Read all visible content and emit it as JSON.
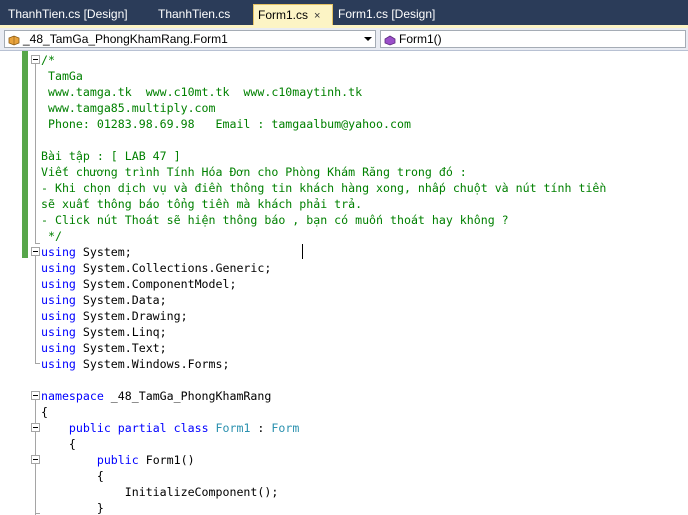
{
  "tabs": [
    {
      "label": "ThanhTien.cs [Design]",
      "active": false
    },
    {
      "label": "ThanhTien.cs",
      "active": false
    },
    {
      "label": "Form1.cs",
      "active": true,
      "close": "×"
    },
    {
      "label": "Form1.cs [Design]",
      "active": false
    }
  ],
  "nav": {
    "type_dropdown": "_48_TamGa_PhongKhamRang.Form1",
    "member_dropdown": "Form1()"
  },
  "code_lines": [
    [
      {
        "t": "/*",
        "c": "cm"
      }
    ],
    [
      {
        "t": " TamGa",
        "c": "cm"
      }
    ],
    [
      {
        "t": " www.tamga.tk  www.c10mt.tk  www.c10maytinh.tk",
        "c": "cm"
      }
    ],
    [
      {
        "t": " www.tamga85.multiply.com",
        "c": "cm"
      }
    ],
    [
      {
        "t": " Phone: 01283.98.69.98   Email : tamgaalbum@yahoo.com",
        "c": "cm"
      }
    ],
    [],
    [
      {
        "t": "Bài tập : [ LAB 47 ]",
        "c": "cm"
      }
    ],
    [
      {
        "t": "Viết chương trình Tính Hóa Đơn cho Phòng Khám Răng trong đó :",
        "c": "cm"
      }
    ],
    [
      {
        "t": "- Khi chọn dịch vụ và điền thông tin khách hàng xong, nhấp chuột và nút tính tiền",
        "c": "cm"
      }
    ],
    [
      {
        "t": "sẽ xuất thông báo tổng tiền mà khách phải trả.",
        "c": "cm"
      }
    ],
    [
      {
        "t": "- Click nút Thoát sẽ hiện thông báo , bạn có muốn thoát hay không ?",
        "c": "cm"
      }
    ],
    [
      {
        "t": " */",
        "c": "cm"
      }
    ],
    [
      {
        "t": "using",
        "c": "kw"
      },
      {
        "t": " System;",
        "c": ""
      }
    ],
    [
      {
        "t": "using",
        "c": "kw"
      },
      {
        "t": " System.Collections.Generic;",
        "c": ""
      }
    ],
    [
      {
        "t": "using",
        "c": "kw"
      },
      {
        "t": " System.ComponentModel;",
        "c": ""
      }
    ],
    [
      {
        "t": "using",
        "c": "kw"
      },
      {
        "t": " System.Data;",
        "c": ""
      }
    ],
    [
      {
        "t": "using",
        "c": "kw"
      },
      {
        "t": " System.Drawing;",
        "c": ""
      }
    ],
    [
      {
        "t": "using",
        "c": "kw"
      },
      {
        "t": " System.Linq;",
        "c": ""
      }
    ],
    [
      {
        "t": "using",
        "c": "kw"
      },
      {
        "t": " System.Text;",
        "c": ""
      }
    ],
    [
      {
        "t": "using",
        "c": "kw"
      },
      {
        "t": " System.Windows.Forms;",
        "c": ""
      }
    ],
    [],
    [
      {
        "t": "namespace",
        "c": "kw"
      },
      {
        "t": " _48_TamGa_PhongKhamRang",
        "c": ""
      }
    ],
    [
      {
        "t": "{",
        "c": ""
      }
    ],
    [
      {
        "t": "    ",
        "c": ""
      },
      {
        "t": "public",
        "c": "kw"
      },
      {
        "t": " ",
        "c": ""
      },
      {
        "t": "partial",
        "c": "kw"
      },
      {
        "t": " ",
        "c": ""
      },
      {
        "t": "class",
        "c": "kw"
      },
      {
        "t": " ",
        "c": ""
      },
      {
        "t": "Form1",
        "c": "ty"
      },
      {
        "t": " : ",
        "c": ""
      },
      {
        "t": "Form",
        "c": "ty"
      }
    ],
    [
      {
        "t": "    {",
        "c": ""
      }
    ],
    [
      {
        "t": "        ",
        "c": ""
      },
      {
        "t": "public",
        "c": "kw"
      },
      {
        "t": " Form1()",
        "c": ""
      }
    ],
    [
      {
        "t": "        {",
        "c": ""
      }
    ],
    [
      {
        "t": "            InitializeComponent();",
        "c": ""
      }
    ],
    [
      {
        "t": "        }",
        "c": ""
      }
    ]
  ],
  "colors": {
    "tab_bar": "#2b3c59",
    "active_tab": "#fcf4c5",
    "comment": "#008000",
    "keyword": "#0000ff",
    "type": "#2b91af",
    "change_bar": "#57a64a"
  },
  "icons": {
    "type_dropdown": "csharp-class-icon",
    "member_dropdown": "method-icon"
  }
}
